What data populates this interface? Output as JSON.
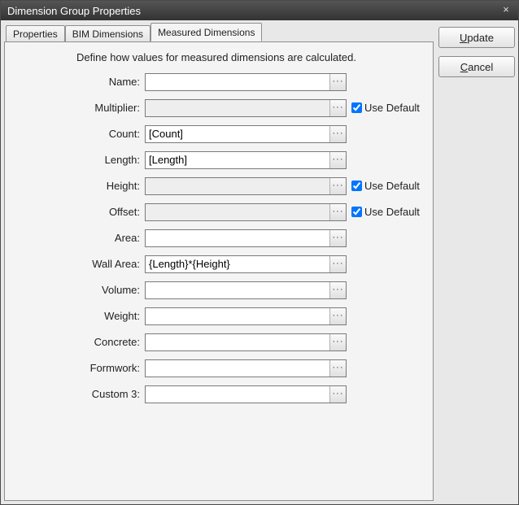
{
  "window": {
    "title": "Dimension Group Properties",
    "close_glyph": "×"
  },
  "tabs": [
    {
      "label": "Properties"
    },
    {
      "label": "BIM Dimensions"
    },
    {
      "label": "Measured Dimensions"
    }
  ],
  "intro": "Define how values for measured dimensions are calculated.",
  "use_default_label": "Use Default",
  "ellipsis": "···",
  "buttons": {
    "update_ukey": "U",
    "update_rest": "pdate",
    "cancel_ukey": "C",
    "cancel_rest": "ancel"
  },
  "fields": {
    "name": {
      "label": "Name:",
      "value": "",
      "disabled": false,
      "use_default": null
    },
    "multiplier": {
      "label": "Multiplier:",
      "value": "",
      "disabled": true,
      "use_default": true
    },
    "count": {
      "label": "Count:",
      "value": "[Count]",
      "disabled": false,
      "use_default": null
    },
    "length": {
      "label": "Length:",
      "value": "[Length]",
      "disabled": false,
      "use_default": null
    },
    "height": {
      "label": "Height:",
      "value": "",
      "disabled": true,
      "use_default": true
    },
    "offset": {
      "label": "Offset:",
      "value": "",
      "disabled": true,
      "use_default": true
    },
    "area": {
      "label": "Area:",
      "value": "",
      "disabled": false,
      "use_default": null
    },
    "wall_area": {
      "label": "Wall Area:",
      "value": "{Length}*{Height}",
      "disabled": false,
      "use_default": null
    },
    "volume": {
      "label": "Volume:",
      "value": "",
      "disabled": false,
      "use_default": null
    },
    "weight": {
      "label": "Weight:",
      "value": "",
      "disabled": false,
      "use_default": null
    },
    "concrete": {
      "label": "Concrete:",
      "value": "",
      "disabled": false,
      "use_default": null
    },
    "formwork": {
      "label": "Formwork:",
      "value": "",
      "disabled": false,
      "use_default": null
    },
    "custom3": {
      "label": "Custom 3:",
      "value": "",
      "disabled": false,
      "use_default": null
    }
  }
}
